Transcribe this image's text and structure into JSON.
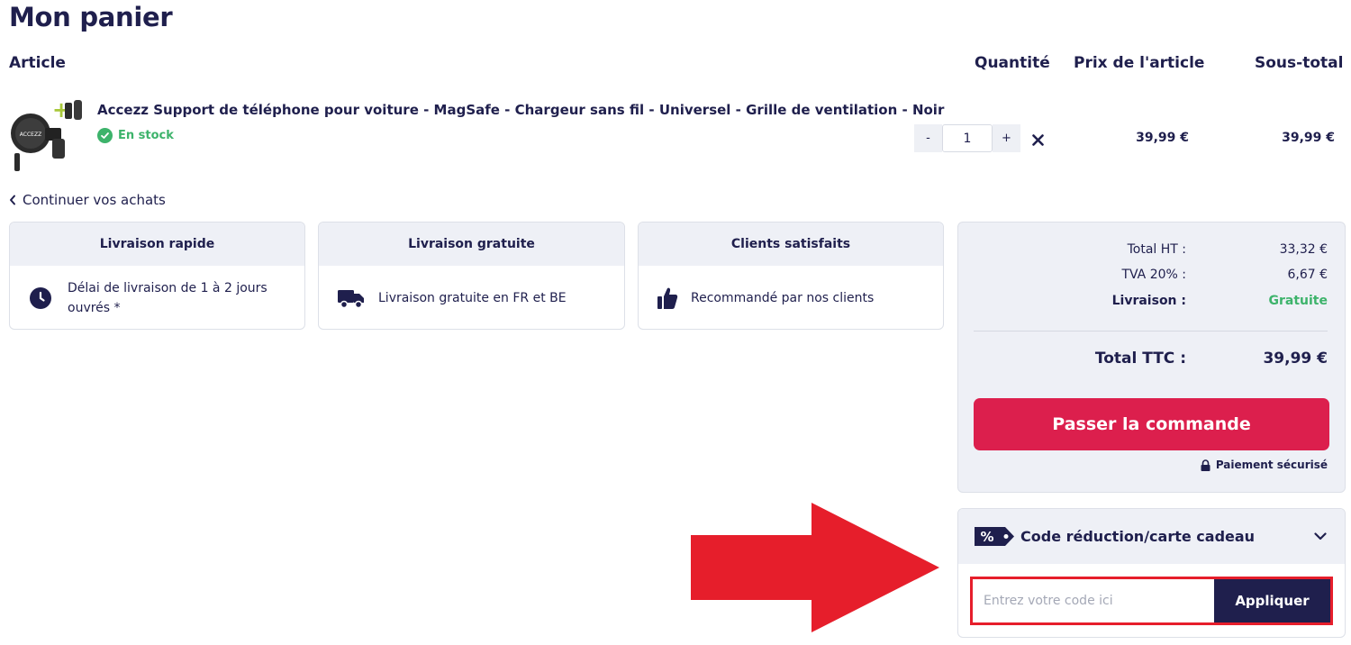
{
  "page": {
    "title": "Mon panier"
  },
  "columns": {
    "article": "Article",
    "quantity": "Quantité",
    "unit_price": "Prix de l'article",
    "subtotal": "Sous-total"
  },
  "cart_item": {
    "name": "Accezz Support de téléphone pour voiture - MagSafe - Chargeur sans fil - Universel - Grille de ventilation - Noir",
    "stock": "En stock",
    "quantity": "1",
    "decrement": "-",
    "increment": "+",
    "unit_price": "39,99 €",
    "subtotal": "39,99 €",
    "image_brand": "ACCEZZ"
  },
  "continue_link": "Continuer vos achats",
  "features": [
    {
      "title": "Livraison rapide",
      "text": "Délai de livraison de 1 à 2 jours ouvrés *",
      "icon": "clock-icon"
    },
    {
      "title": "Livraison gratuite",
      "text": "Livraison gratuite en FR et BE",
      "icon": "truck-icon"
    },
    {
      "title": "Clients satisfaits",
      "text": "Recommandé par nos clients",
      "icon": "thumbs-up-icon"
    }
  ],
  "summary": {
    "total_ht_label": "Total HT :",
    "total_ht_value": "33,32 €",
    "tva_label": "TVA 20% :",
    "tva_value": "6,67 €",
    "shipping_label": "Livraison :",
    "shipping_value": "Gratuite",
    "total_ttc_label": "Total TTC :",
    "total_ttc_value": "39,99 €",
    "order_button": "Passer la commande",
    "secure_text": "Paiement sécurisé"
  },
  "promo": {
    "tag": "%",
    "title": "Code réduction/carte cadeau",
    "placeholder": "Entrez votre code ici",
    "apply_button": "Appliquer"
  },
  "colors": {
    "navy": "#1f1f4d",
    "accent_red": "#dc1f4d",
    "success_green": "#3db36b",
    "panel_bg": "#eef0f6",
    "highlight_red": "#e61e2b"
  }
}
